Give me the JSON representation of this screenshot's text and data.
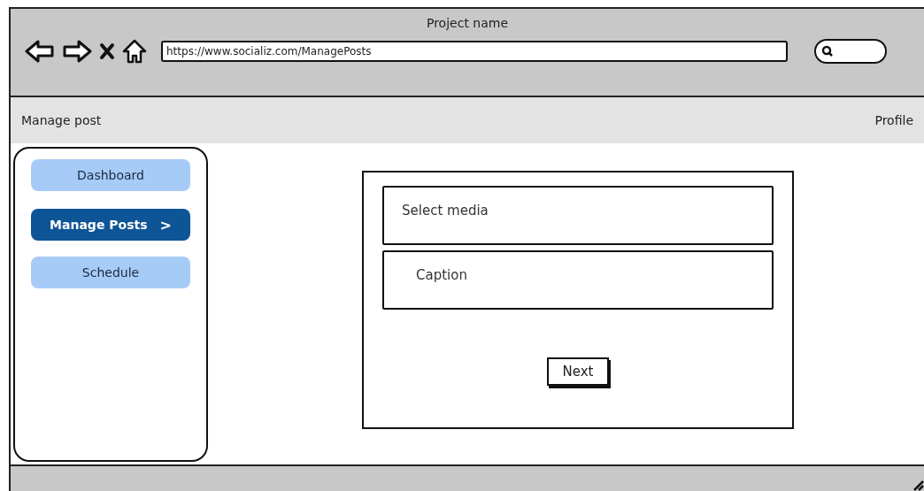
{
  "window": {
    "title": "Project name",
    "url": "https://www.socializ.com/ManagePosts"
  },
  "header": {
    "title": "Manage post",
    "profile": "Profile"
  },
  "sidebar": {
    "items": [
      {
        "label": "Dashboard",
        "selected": false
      },
      {
        "label": "Manage Posts",
        "selected": true,
        "chevron": ">"
      },
      {
        "label": "Schedule",
        "selected": false
      }
    ]
  },
  "form": {
    "fields": [
      {
        "placeholder": "Select media",
        "indent": false
      },
      {
        "placeholder": "Caption",
        "indent": true
      }
    ],
    "button": "Next"
  }
}
